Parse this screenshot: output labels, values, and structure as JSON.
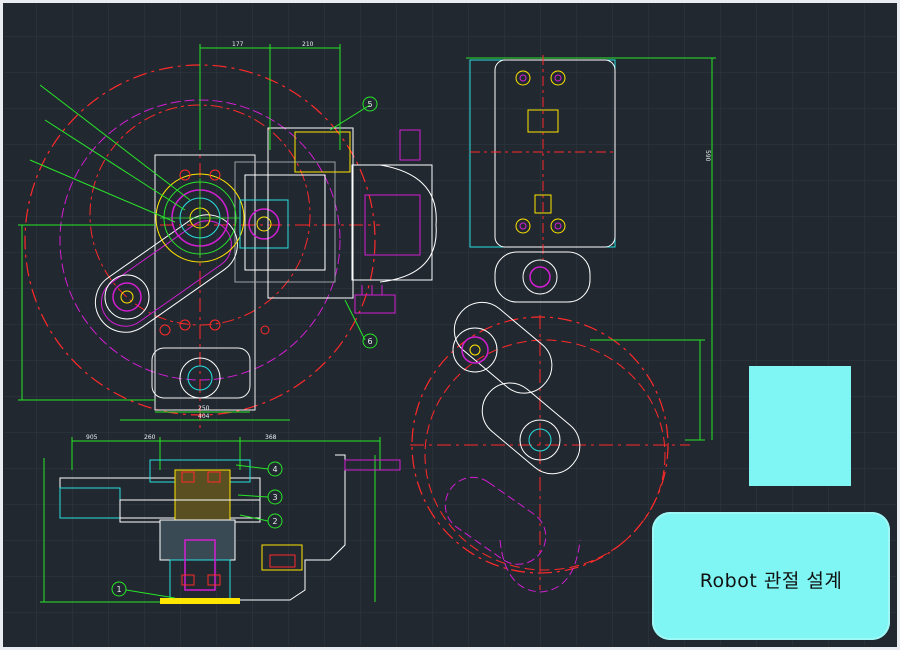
{
  "balloons": [
    "1",
    "2",
    "3",
    "4",
    "5",
    "6"
  ],
  "dimensions": {
    "top_a": "177",
    "top_b": "210",
    "bottom_a": "250",
    "bottom_b": "404",
    "side_a": "905",
    "side_b": "260",
    "side_c": "368",
    "right_a": "590"
  },
  "note_text": "Robot 관절 설계",
  "colors": {
    "background": "#212830",
    "frame": "#e9edf2",
    "note_fill": "#7ff6f4"
  }
}
